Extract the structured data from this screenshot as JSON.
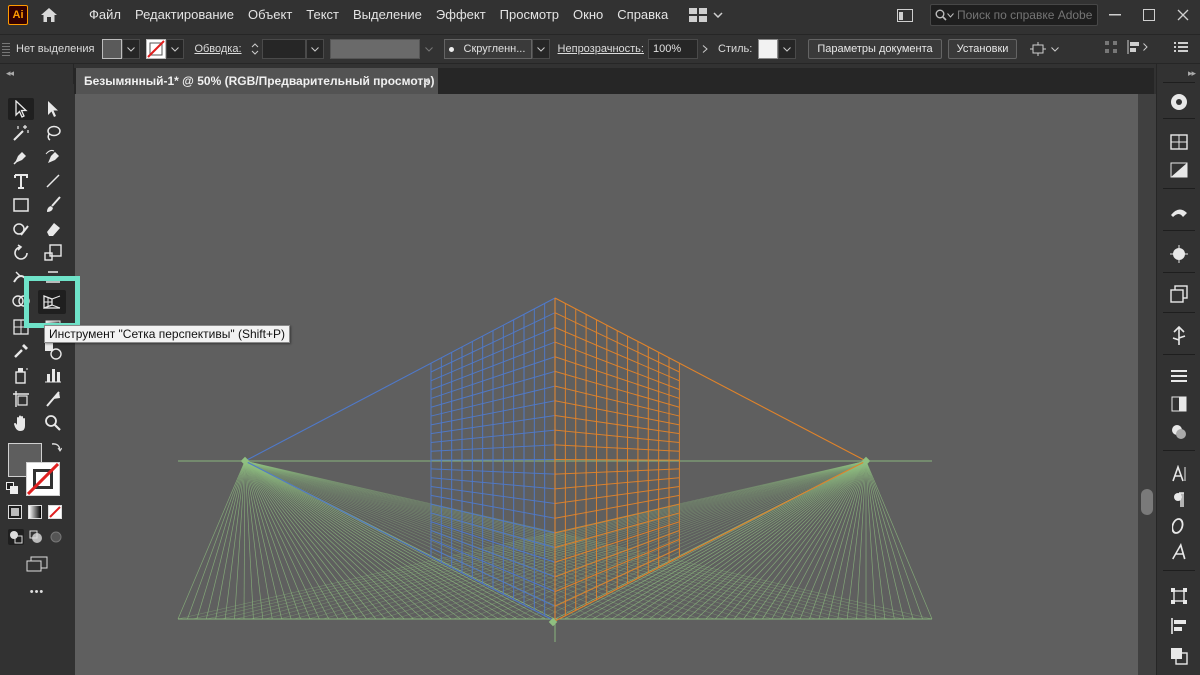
{
  "app": {
    "logo_text": "Ai",
    "accent": "#ff9a00"
  },
  "menu": {
    "items": [
      "Файл",
      "Редактирование",
      "Объект",
      "Текст",
      "Выделение",
      "Эффект",
      "Просмотр",
      "Окно",
      "Справка"
    ]
  },
  "search": {
    "placeholder": "Поиск по справке Adobe"
  },
  "control_bar": {
    "selection_label": "Нет выделения",
    "stroke_label": "Обводка:",
    "brush_label": "Скругленн...",
    "opacity_label": "Непрозрачность:",
    "opacity_value": "100%",
    "styles_label": "Стиль:",
    "doc_setup_label": "Параметры документа",
    "prefs_label": "Установки"
  },
  "document": {
    "tab_title": "Безымянный-1* @ 50% (RGB/Предварительный просмотр)",
    "close_glyph": "×"
  },
  "left_panel": {
    "collapse_glyph": "◂◂",
    "more_glyph": "•••"
  },
  "right_panel": {
    "collapse_glyph": "▸▸"
  },
  "tooltip": {
    "text": "Инструмент \"Сетка перспективы\" (Shift+P)"
  },
  "colors": {
    "canvas_bg": "#5f5f5f",
    "grid_left": "#4f79c9",
    "grid_right": "#e0832a",
    "grid_ground": "#8fbf80",
    "highlight": "#6fe3c9"
  }
}
